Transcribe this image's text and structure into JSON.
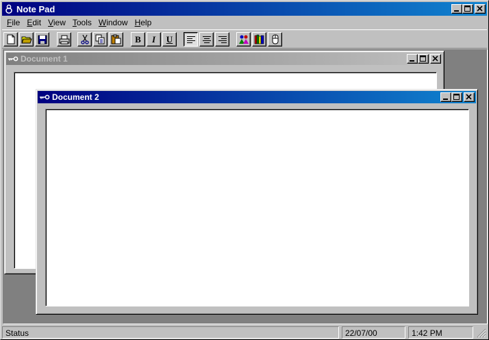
{
  "app": {
    "title": "Note Pad"
  },
  "menu": [
    {
      "label": "File",
      "mnemonic": "F",
      "rest": "ile"
    },
    {
      "label": "Edit",
      "mnemonic": "E",
      "rest": "dit"
    },
    {
      "label": "View",
      "mnemonic": "V",
      "rest": "iew"
    },
    {
      "label": "Tools",
      "mnemonic": "T",
      "rest": "ools"
    },
    {
      "label": "Window",
      "mnemonic": "W",
      "rest": "indow"
    },
    {
      "label": "Help",
      "mnemonic": "H",
      "rest": "elp"
    }
  ],
  "toolbar": {
    "bold_label": "B",
    "italic_label": "I",
    "underline_label": "U",
    "icons": [
      "new-document-icon",
      "open-folder-icon",
      "save-disk-icon",
      "print-icon",
      "cut-scissors-icon",
      "copy-icon",
      "paste-clipboard-icon",
      "bold-icon",
      "italic-icon",
      "underline-icon",
      "align-left-icon",
      "align-center-icon",
      "align-right-icon",
      "people-icon",
      "books-icon",
      "mouse-icon"
    ]
  },
  "documents": [
    {
      "title": "Document 1",
      "active": false
    },
    {
      "title": "Document 2",
      "active": true
    }
  ],
  "status": {
    "text": "Status",
    "date": "22/07/00",
    "time": "1:42 PM"
  },
  "colors": {
    "active_title": "#000080",
    "inactive_title": "#808080",
    "face": "#c0c0c0",
    "mdi_background": "#808080"
  }
}
